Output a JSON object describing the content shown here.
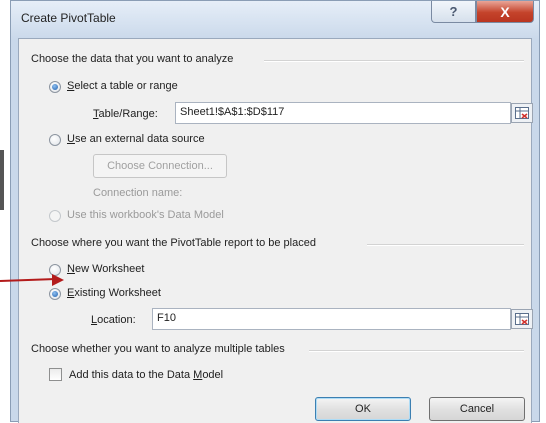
{
  "dialog": {
    "title": "Create PivotTable",
    "help_glyph": "?",
    "close_glyph": "X"
  },
  "data_section": {
    "label": "Choose the data that you want to analyze",
    "select_range": {
      "pre": "",
      "accel": "S",
      "post": "elect a table or range",
      "checked": true
    },
    "table_range": {
      "accel": "T",
      "post": "able/Range:",
      "value": "Sheet1!$A$1:$D$117"
    },
    "external": {
      "accel": "U",
      "post": "se an external data source",
      "checked": false
    },
    "choose_connection": "Choose Connection...",
    "connection_name_label": "Connection name:",
    "data_model": {
      "label": "Use this workbook's Data Model",
      "disabled": true
    }
  },
  "placement_section": {
    "label": "Choose where you want the PivotTable report to be placed",
    "new_worksheet": {
      "accel": "N",
      "post": "ew Worksheet",
      "checked": false
    },
    "existing_worksheet": {
      "accel": "E",
      "post": "xisting Worksheet",
      "checked": true
    },
    "location": {
      "accel": "L",
      "post": "ocation:",
      "value": "F10"
    }
  },
  "multiple_section": {
    "label": "Choose whether you want to analyze multiple tables",
    "add_to_model": {
      "pre": "Add this data to the Data ",
      "accel": "M",
      "post": "odel",
      "checked": false
    }
  },
  "buttons": {
    "ok": "OK",
    "cancel": "Cancel"
  }
}
